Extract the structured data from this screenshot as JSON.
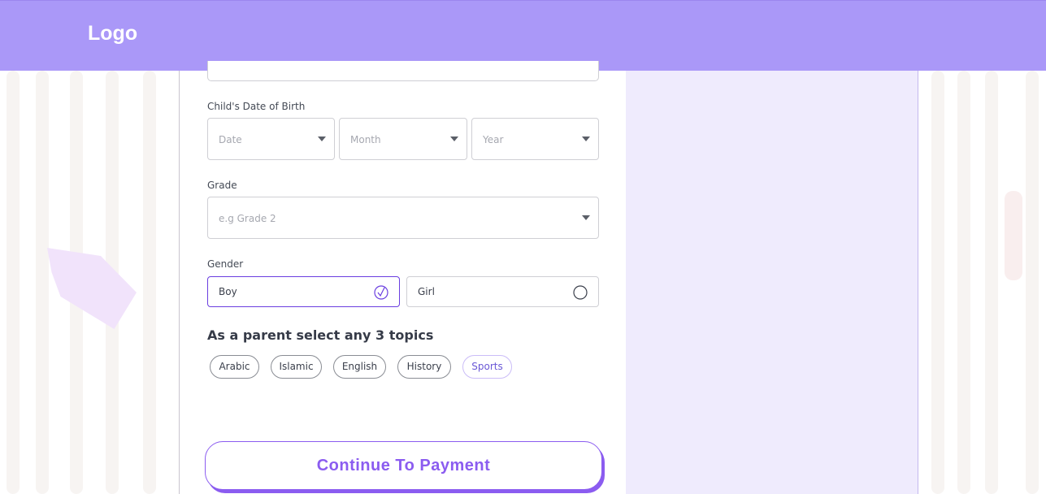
{
  "header": {
    "logo": "Logo",
    "color": "#aa98f8"
  },
  "form": {
    "dob": {
      "label": "Child's Date of Birth",
      "date_placeholder": "Date",
      "month_placeholder": "Month",
      "year_placeholder": "Year"
    },
    "grade": {
      "label": "Grade",
      "placeholder": "e.g Grade 2"
    },
    "gender": {
      "label": "Gender",
      "options": [
        {
          "label": "Boy",
          "selected": true
        },
        {
          "label": "Girl",
          "selected": false
        }
      ]
    },
    "topics": {
      "title": "As a parent select any 3 topics",
      "chips": [
        "Arabic",
        "Islamic",
        "English",
        "History",
        "Sports"
      ],
      "active": "Sports"
    },
    "continue_label": "Continue To Payment"
  },
  "colors": {
    "accent": "#8b5cf0",
    "selected_border": "#6a3ee0",
    "side_panel": "#efebfd"
  }
}
